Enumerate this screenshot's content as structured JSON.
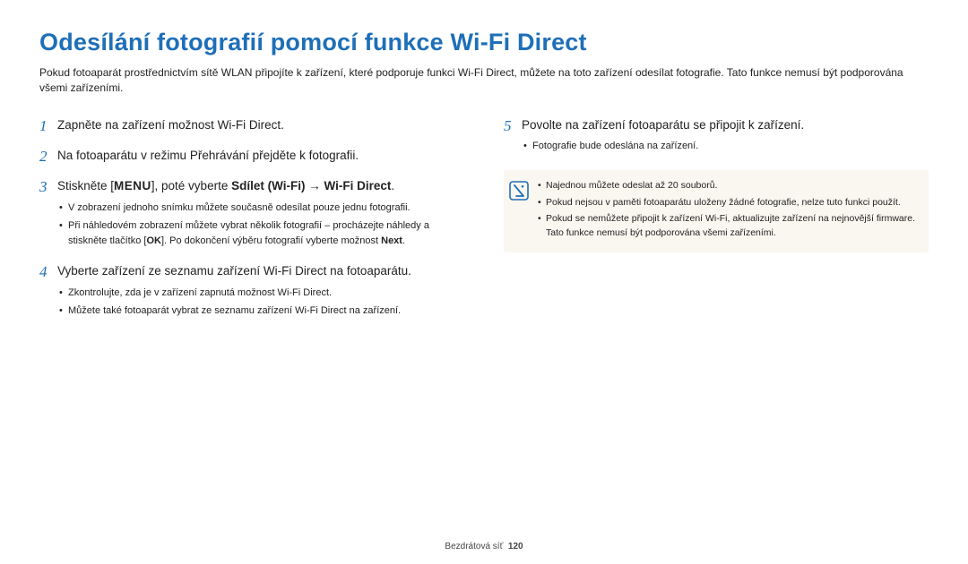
{
  "title": "Odesílání fotografií pomocí funkce Wi-Fi Direct",
  "intro": "Pokud fotoaparát prostřednictvím sítě WLAN připojíte k zařízení, které podporuje funkci Wi-Fi Direct, můžete na toto zařízení odesílat fotografie. Tato funkce nemusí být podporována všemi zařízeními.",
  "steps": {
    "s1": {
      "num": "1",
      "text": "Zapněte na zařízení možnost Wi-Fi Direct."
    },
    "s2": {
      "num": "2",
      "text": "Na fotoaparátu v režimu Přehrávání přejděte k fotografii."
    },
    "s3": {
      "num": "3",
      "prefix": "Stiskněte [",
      "menu": "MENU",
      "mid": "], poté vyberte ",
      "bold1": "Sdílet (Wi-Fi)",
      "arrow": " → ",
      "bold2": "Wi-Fi Direct",
      "suffix": ".",
      "bullets": {
        "b1": "V zobrazení jednoho snímku můžete současně odesílat pouze jednu fotografii.",
        "b2a": "Při náhledovém zobrazení můžete vybrat několik fotografií – procházejte náhledy a stiskněte tlačítko [",
        "b2ok": "OK",
        "b2b": "]. Po dokončení výběru fotografií vyberte možnost ",
        "b2next": "Next",
        "b2c": "."
      }
    },
    "s4": {
      "num": "4",
      "text": "Vyberte zařízení ze seznamu zařízení Wi-Fi Direct na fotoaparátu.",
      "bullets": {
        "b1": "Zkontrolujte, zda je v zařízení zapnutá možnost Wi-Fi Direct.",
        "b2": "Můžete také fotoaparát vybrat ze seznamu zařízení Wi-Fi Direct na zařízení."
      }
    },
    "s5": {
      "num": "5",
      "text": "Povolte na zařízení fotoaparátu se připojit k zařízení.",
      "bullets": {
        "b1": "Fotografie bude odeslána na zařízení."
      }
    }
  },
  "notes": {
    "n1": "Najednou můžete odeslat až 20 souborů.",
    "n2": "Pokud nejsou v paměti fotoaparátu uloženy žádné fotografie, nelze tuto funkci použít.",
    "n3": "Pokud se nemůžete připojit k zařízení Wi-Fi, aktualizujte zařízení na nejnovější firmware. Tato funkce nemusí být podporována všemi zařízeními."
  },
  "footer": {
    "section": "Bezdrátová síť",
    "page": "120"
  }
}
